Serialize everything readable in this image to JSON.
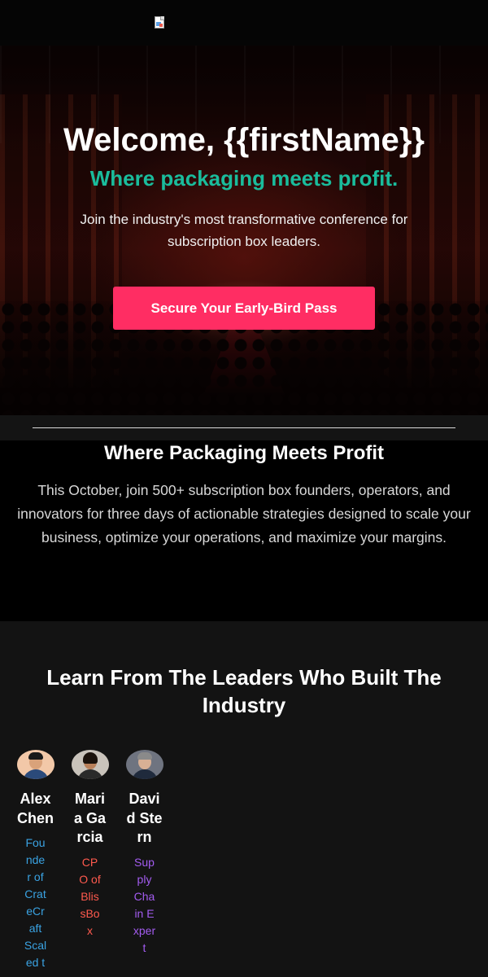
{
  "header": {
    "logo_icon": "broken-image-icon"
  },
  "hero": {
    "title": "Welcome, {{firstName}}",
    "subtitle": "Where packaging meets profit.",
    "description": "Join the industry's most transformative conference for subscription box leaders.",
    "cta_label": "Secure Your Early-Bird Pass",
    "colors": {
      "subtitle": "#1abc9c",
      "cta": "#ff2d63"
    }
  },
  "intro": {
    "heading": "Where Packaging Meets Profit",
    "body": "This October, join 500+ subscription box founders, operators, and innovators for three days of actionable strategies designed to scale your business, optimize your operations, and maximize your margins."
  },
  "speakers": {
    "heading": "Learn From The Leaders Who Built The Industry",
    "items": [
      {
        "name": "Alex Chen",
        "role": "Founder of CrateCraft Scaled to",
        "role_color": "#3aa3e3"
      },
      {
        "name": "Maria Garcia",
        "role": "CPO of BlissBox",
        "role_color": "#ff5a4e"
      },
      {
        "name": "David Stern",
        "role": "Supply Chain Expert",
        "role_color": "#a35cf0"
      }
    ]
  }
}
